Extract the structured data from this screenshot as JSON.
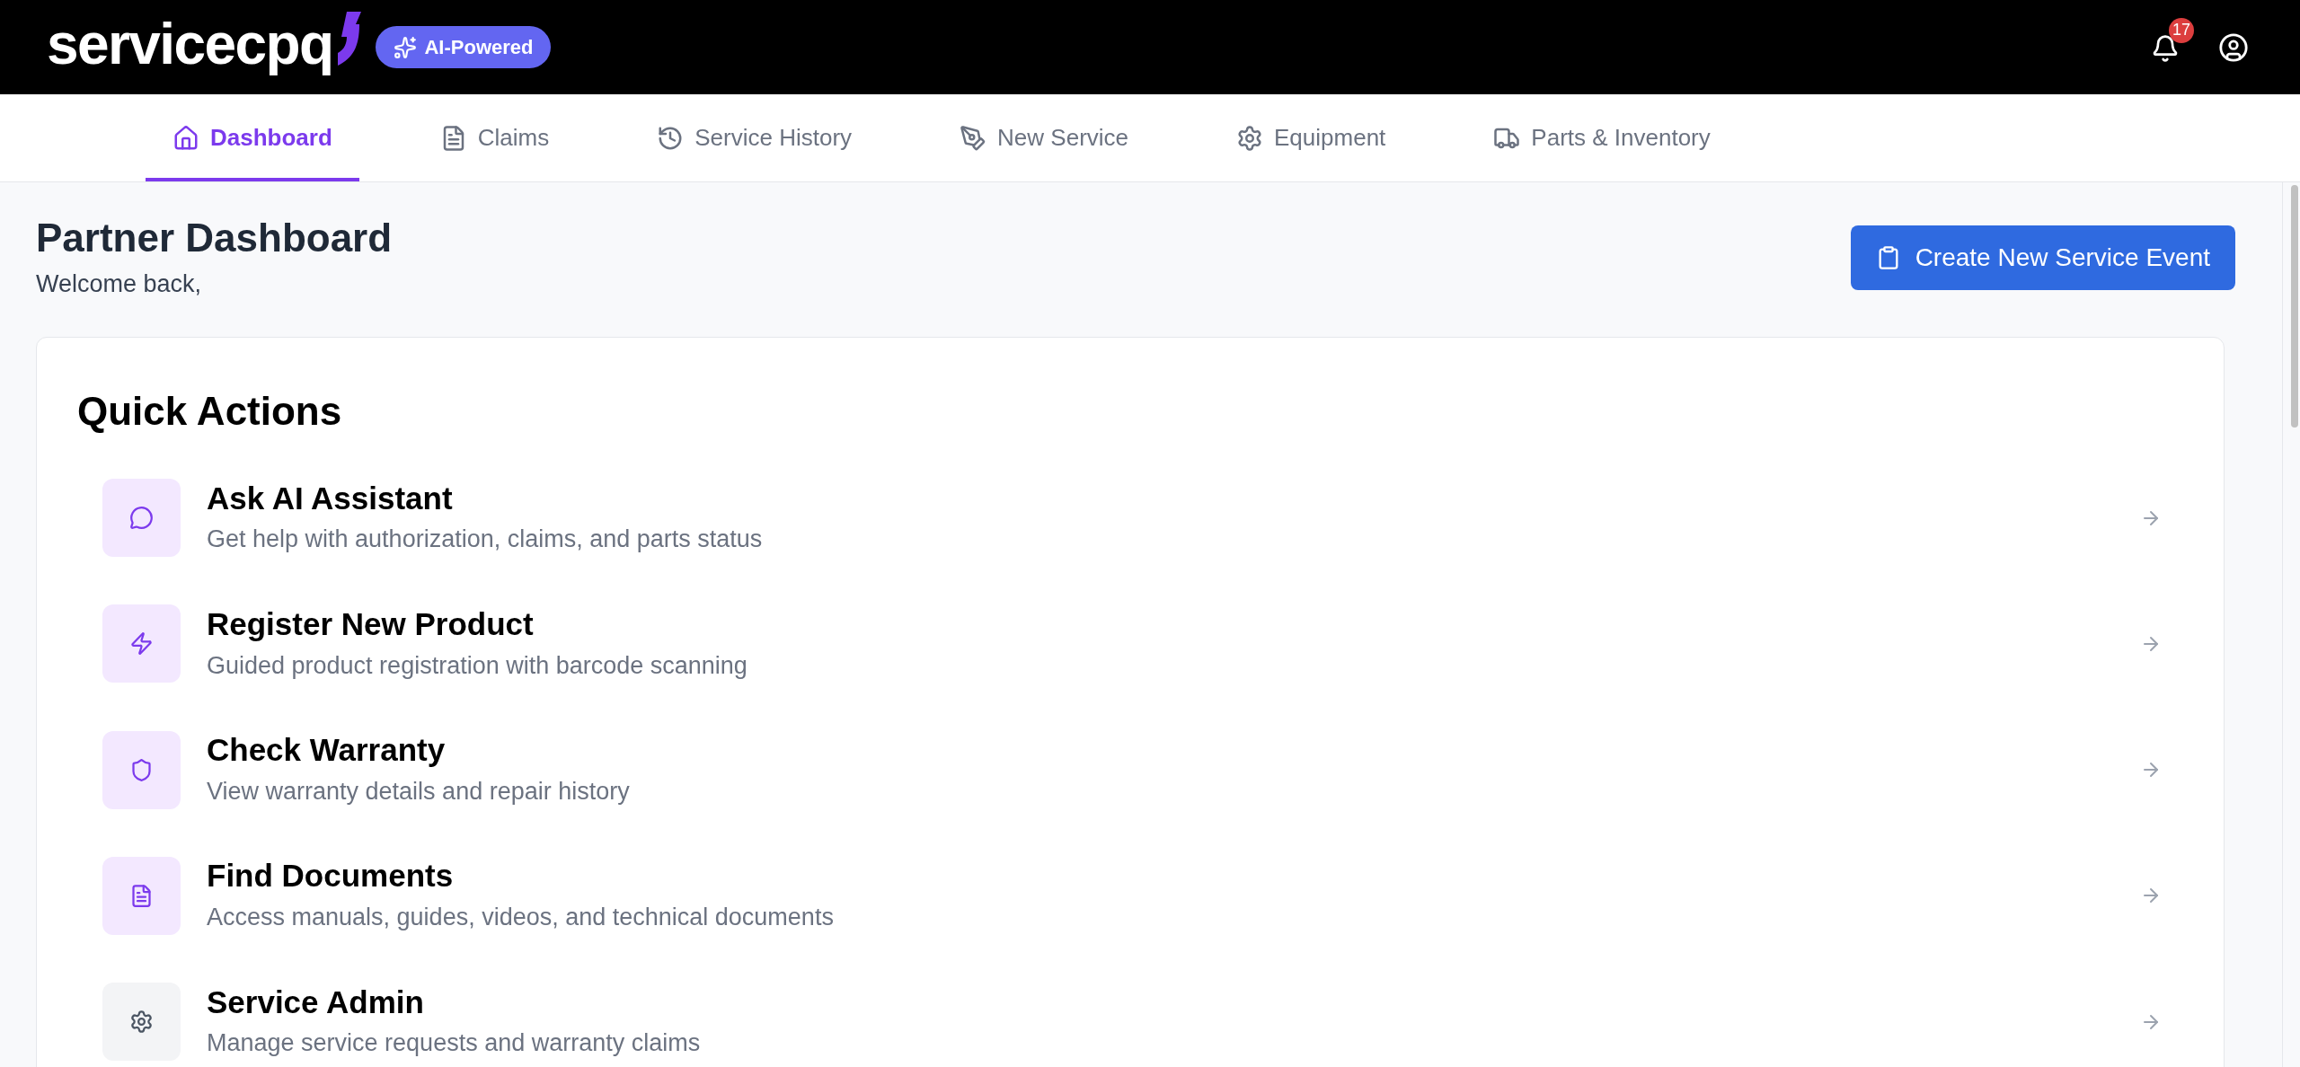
{
  "header": {
    "logo": "servicecpq",
    "badge": "AI-Powered",
    "notifications": "17"
  },
  "tabs": [
    {
      "label": "Dashboard",
      "selected": true
    },
    {
      "label": "Claims",
      "selected": false
    },
    {
      "label": "Service History",
      "selected": false
    },
    {
      "label": "New Service",
      "selected": false
    },
    {
      "label": "Equipment",
      "selected": false
    },
    {
      "label": "Parts & Inventory",
      "selected": false
    }
  ],
  "page": {
    "title": "Partner Dashboard",
    "subtitle": "Welcome back,",
    "primary_button": "Create New Service Event"
  },
  "quick_actions": {
    "title": "Quick Actions",
    "items": [
      {
        "title": "Ask AI Assistant",
        "description": "Get help with authorization, claims, and parts status",
        "color": "#f3e8ff"
      },
      {
        "title": "Register New Product",
        "description": "Guided product registration with barcode scanning",
        "color": "#f3e8ff"
      },
      {
        "title": "Check Warranty",
        "description": "View warranty details and repair history",
        "color": "#f3e8ff"
      },
      {
        "title": "Find Documents",
        "description": "Access manuals, guides, videos, and technical documents",
        "color": "#f3e8ff"
      },
      {
        "title": "Service Admin",
        "description": "Manage service requests and warranty claims",
        "color": "#f3f4f6"
      }
    ]
  }
}
